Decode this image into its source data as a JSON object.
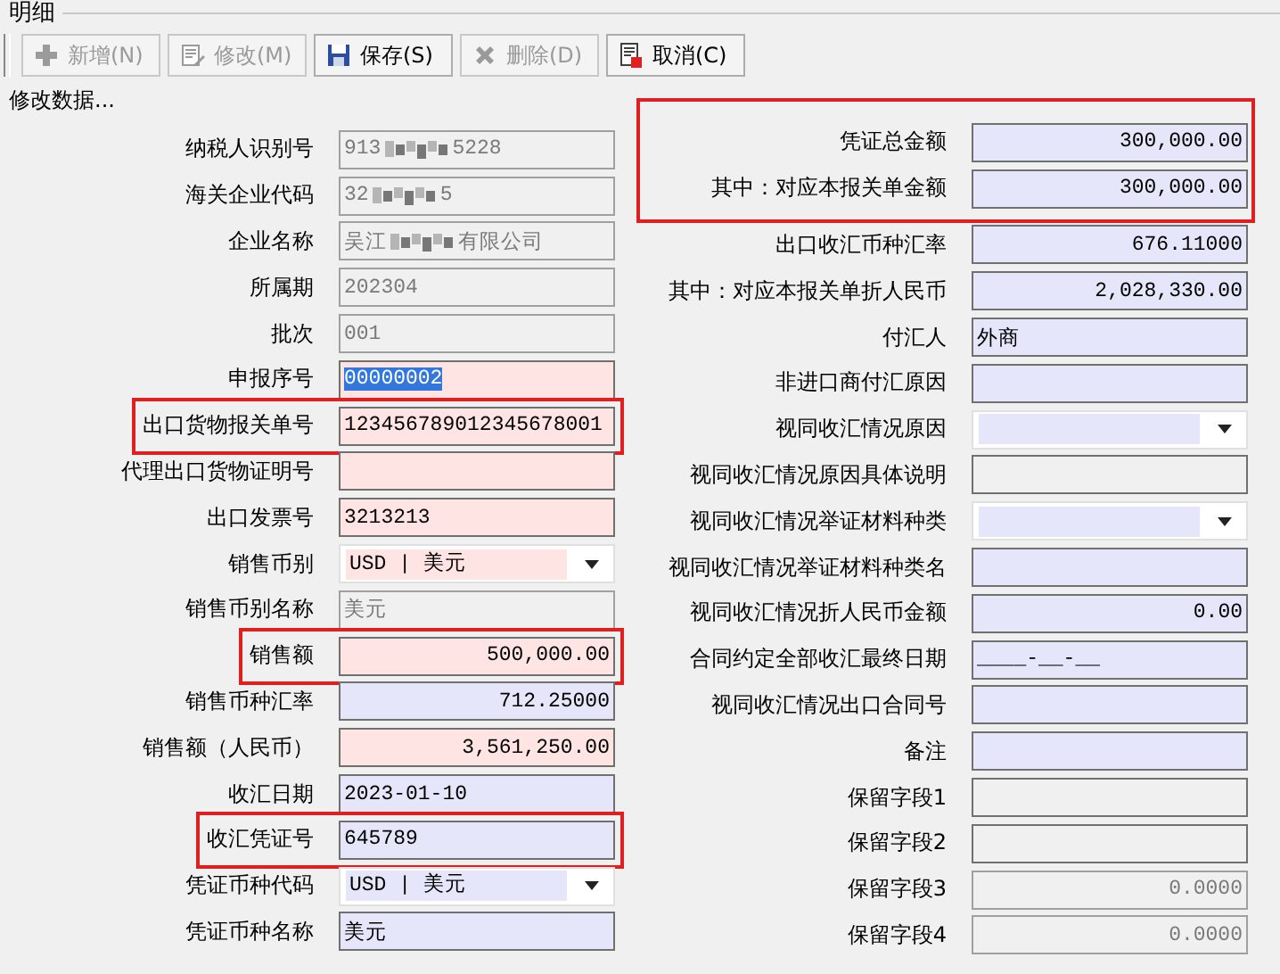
{
  "panel_title": "明细",
  "toolbar": [
    {
      "label": "新增(N)",
      "disabled": true
    },
    {
      "label": "修改(M)",
      "disabled": true
    },
    {
      "label": "保存(S)",
      "disabled": false
    },
    {
      "label": "删除(D)",
      "disabled": true
    },
    {
      "label": "取消(C)",
      "disabled": false
    }
  ],
  "mode_label": "修改数据...",
  "left_fields": [
    {
      "label": "纳税人识别号",
      "kind": "masked",
      "value_start": "913",
      "value_end": "5228",
      "color": "#f0f0f0",
      "disabled": true,
      "highlighted": false
    },
    {
      "label": "海关企业代码",
      "kind": "masked",
      "value_start": "32",
      "value_end": "5",
      "color": "#f0f0f0",
      "disabled": true,
      "highlighted": false
    },
    {
      "label": "企业名称",
      "kind": "masked",
      "value_start": "吴江",
      "value_end": "有限公司",
      "color": "#f0f0f0",
      "disabled": true,
      "highlighted": false
    },
    {
      "label": "所属期",
      "kind": "text",
      "value": "202304",
      "color": "#f0f0f0",
      "disabled": true,
      "highlighted": false
    },
    {
      "label": "批次",
      "kind": "text",
      "value": "001",
      "color": "#f0f0f0",
      "disabled": true,
      "highlighted": false
    },
    {
      "label": "申报序号",
      "kind": "text",
      "value": "00000002",
      "color": "#ffe4e4",
      "disabled": false,
      "highlighted": false,
      "text_selected": true
    },
    {
      "label": "出口货物报关单号",
      "kind": "text",
      "value": "123456789012345678001",
      "color": "#ffe4e4",
      "disabled": false,
      "highlighted": true
    },
    {
      "label": "代理出口货物证明号",
      "kind": "text",
      "color": "#ffe4e4",
      "disabled": false,
      "highlighted": false
    },
    {
      "label": "出口发票号",
      "kind": "text",
      "value": "3213213",
      "color": "#ffe4e4",
      "disabled": false,
      "highlighted": false
    },
    {
      "label": "销售币别",
      "kind": "select",
      "value": "USD | 美元",
      "color": "#ffe4e4",
      "disabled": false,
      "highlighted": false
    },
    {
      "label": "销售币别名称",
      "kind": "text",
      "value": "美元",
      "color": "#f0f0f0",
      "disabled": true,
      "highlighted": false
    },
    {
      "label": "销售额",
      "kind": "number",
      "value": "500,000.00",
      "color": "#ffe4e4",
      "disabled": false,
      "highlighted": true
    },
    {
      "label": "销售币种汇率",
      "kind": "number",
      "value": "712.25000",
      "color": "#e6e6fa",
      "disabled": false,
      "highlighted": false
    },
    {
      "label": "销售额（人民币）",
      "kind": "number",
      "value": "3,561,250.00",
      "color": "#ffe4e4",
      "disabled": false,
      "highlighted": false
    },
    {
      "label": "收汇日期",
      "kind": "text",
      "value": "2023-01-10",
      "color": "#e6e6fa",
      "disabled": false,
      "highlighted": false
    },
    {
      "label": "收汇凭证号",
      "kind": "text",
      "value": "645789",
      "color": "#e6e6fa",
      "disabled": false,
      "highlighted": true
    },
    {
      "label": "凭证币种代码",
      "kind": "select",
      "value": "USD | 美元",
      "color": "#e6e6fa",
      "disabled": false,
      "highlighted": false
    },
    {
      "label": "凭证币种名称",
      "kind": "text",
      "value": "美元",
      "color": "#e6e6fa",
      "disabled": false,
      "highlighted": false
    }
  ],
  "right_fields": [
    {
      "label": "凭证总金额",
      "kind": "number",
      "value": "300,000.00",
      "color": "#e6e6fa",
      "disabled": false,
      "highlighted": true
    },
    {
      "label": "其中：对应本报关单金额",
      "kind": "number",
      "value": "300,000.00",
      "color": "#e6e6fa",
      "disabled": false,
      "highlighted": true
    },
    {
      "label": "出口收汇币种汇率",
      "kind": "number",
      "value": "676.11000",
      "color": "#e6e6fa",
      "disabled": false,
      "highlighted": false
    },
    {
      "label": "其中：对应本报关单折人民币",
      "kind": "number",
      "value": "2,028,330.00",
      "color": "#e6e6fa",
      "disabled": false,
      "highlighted": false
    },
    {
      "label": "付汇人",
      "kind": "text",
      "value": "外商",
      "color": "#e6e6fa",
      "disabled": false,
      "highlighted": false
    },
    {
      "label": "非进口商付汇原因",
      "kind": "text",
      "color": "#e6e6fa",
      "disabled": false,
      "highlighted": false
    },
    {
      "label": "视同收汇情况原因",
      "kind": "select",
      "color": "#e6e6fa",
      "disabled": false,
      "highlighted": false
    },
    {
      "label": "视同收汇情况原因具体说明",
      "kind": "text",
      "color": "#f0f0f0",
      "disabled": false,
      "highlighted": false
    },
    {
      "label": "视同收汇情况举证材料种类",
      "kind": "select",
      "color": "#e6e6fa",
      "disabled": false,
      "highlighted": false
    },
    {
      "label": "视同收汇情况举证材料种类名",
      "kind": "text",
      "color": "#e6e6fa",
      "disabled": false,
      "highlighted": false
    },
    {
      "label": "视同收汇情况折人民币金额",
      "kind": "number",
      "value": "0.00",
      "color": "#e6e6fa",
      "disabled": false,
      "highlighted": false
    },
    {
      "label": "合同约定全部收汇最终日期",
      "kind": "text",
      "value": "____-__-__",
      "color": "#e6e6fa",
      "disabled": false,
      "highlighted": false
    },
    {
      "label": "视同收汇情况出口合同号",
      "kind": "text",
      "color": "#e6e6fa",
      "disabled": false,
      "highlighted": false
    },
    {
      "label": "备注",
      "kind": "text",
      "color": "#e6e6fa",
      "disabled": false,
      "highlighted": false
    },
    {
      "label": "保留字段1",
      "kind": "text",
      "color": "#f0f0f0",
      "disabled": false,
      "highlighted": false
    },
    {
      "label": "保留字段2",
      "kind": "text",
      "color": "#f0f0f0",
      "disabled": false,
      "highlighted": false
    },
    {
      "label": "保留字段3",
      "kind": "number",
      "value": "0.0000",
      "color": "#f0f0f0",
      "disabled": true,
      "highlighted": false
    },
    {
      "label": "保留字段4",
      "kind": "number",
      "value": "0.0000",
      "color": "#f0f0f0",
      "disabled": true,
      "highlighted": false
    }
  ]
}
